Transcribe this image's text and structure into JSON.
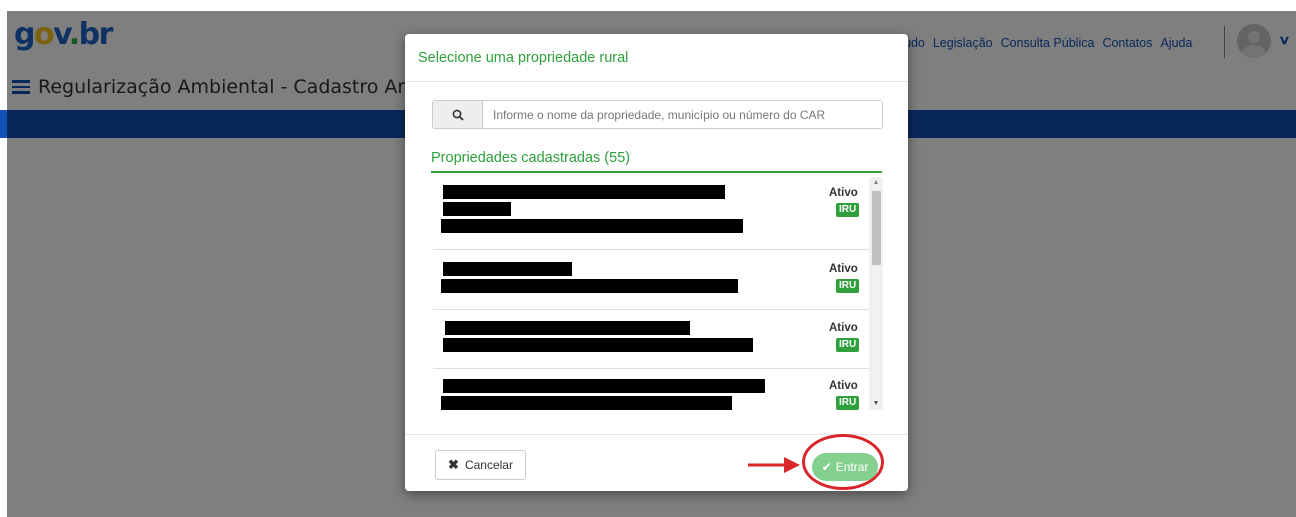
{
  "header": {
    "logo_parts": {
      "g": "g",
      "o": "o",
      "v": "v",
      "dot": ".",
      "br": "br"
    },
    "site_title": "Regularização Ambiental - Cadastro Ambiental Rural",
    "nav": [
      "údo",
      "Legislação",
      "Consulta Pública",
      "Contatos",
      "Ajuda"
    ]
  },
  "modal": {
    "title": "Selecione uma propriedade rural",
    "search": {
      "placeholder": "Informe o nome da propriedade, município ou número do CAR",
      "value": ""
    },
    "section_title": "Propriedades cadastradas (55)",
    "items": [
      {
        "status": "Ativo",
        "badge": "IRU"
      },
      {
        "status": "Ativo",
        "badge": "IRU"
      },
      {
        "status": "Ativo",
        "badge": "IRU"
      },
      {
        "status": "Ativo",
        "badge": "IRU"
      }
    ],
    "footer": {
      "cancel_label": "Cancelar",
      "submit_label": "Entrar"
    }
  },
  "colors": {
    "gov_blue": "#1351b4",
    "green": "#2ea03c",
    "disabled_green": "#84d08f",
    "annotation_red": "#d9262b"
  },
  "icons": [
    "hamburger-icon",
    "user-avatar-icon",
    "chevron-down-icon",
    "search-icon",
    "close-icon",
    "check-icon",
    "scroll-up-icon",
    "scroll-down-icon",
    "annotation-arrow-icon"
  ]
}
